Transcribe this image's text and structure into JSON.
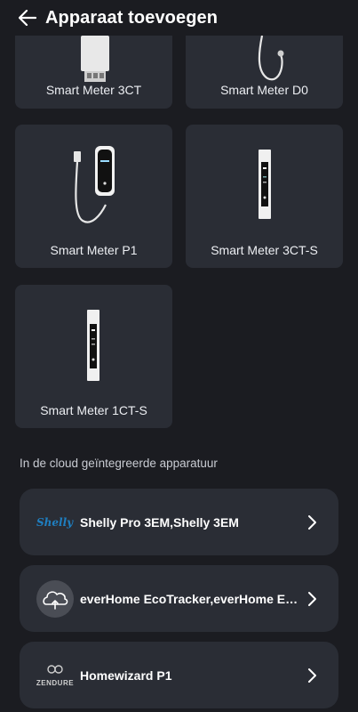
{
  "header": {
    "title": "Apparaat toevoegen"
  },
  "devices": [
    {
      "label": "Smart Meter 3CT"
    },
    {
      "label": "Smart Meter D0"
    },
    {
      "label": "Smart Meter P1"
    },
    {
      "label": "Smart Meter 3CT-S"
    },
    {
      "label": "Smart Meter 1CT-S"
    }
  ],
  "cloud": {
    "heading": "In de cloud geïntegreerde apparatuur",
    "items": [
      {
        "label": "Shelly Pro 3EM,Shelly 3EM",
        "logo": "Shelly"
      },
      {
        "label": "everHome EcoTracker,everHome EcoTracker",
        "logo": "everhome-cloud-icon"
      },
      {
        "label": "Homewizard P1",
        "logo": "ZENDURE"
      }
    ]
  },
  "colors": {
    "background": "#1b1c21",
    "card": "#2a2d35",
    "text": "#ffffff",
    "muted": "#c9ccd3",
    "shelly_blue": "#1f7fc1"
  }
}
